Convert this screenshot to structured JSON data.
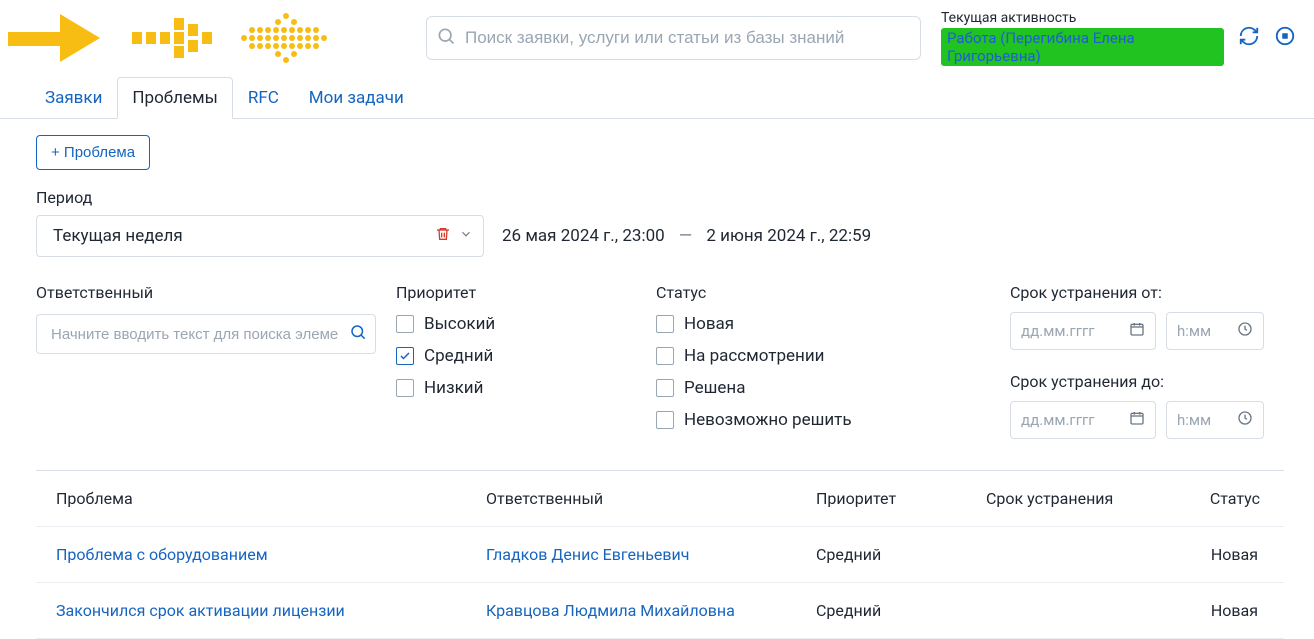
{
  "header": {
    "search_placeholder": "Поиск заявки, услуги или статьи из базы знаний",
    "activity_label": "Текущая активность",
    "activity_badge": "Работа (Перегибина Елена Григорьевна)"
  },
  "tabs": {
    "items": [
      "Заявки",
      "Проблемы",
      "RFC",
      "Мои задачи"
    ],
    "active_index": 1
  },
  "toolbar": {
    "add_button": "+ Проблема"
  },
  "filters": {
    "period_label": "Период",
    "period_value": "Текущая неделя",
    "period_from": "26 мая 2024 г., 23:00",
    "period_to": "2 июня 2024 г., 22:59",
    "responsible_label": "Ответственный",
    "responsible_placeholder": "Начните вводить текст для поиска элеме",
    "priority_label": "Приоритет",
    "priority_options": [
      {
        "label": "Высокий",
        "checked": false
      },
      {
        "label": "Средний",
        "checked": true
      },
      {
        "label": "Низкий",
        "checked": false
      }
    ],
    "status_label": "Статус",
    "status_options": [
      {
        "label": "Новая",
        "checked": false
      },
      {
        "label": "На рассмотрении",
        "checked": false
      },
      {
        "label": "Решена",
        "checked": false
      },
      {
        "label": "Невозможно решить",
        "checked": false
      }
    ],
    "due_from_label": "Срок устранения от:",
    "due_to_label": "Срок устранения до:",
    "date_placeholder": "дд.мм.гггг",
    "time_placeholder": "h:мм"
  },
  "table": {
    "headers": {
      "problem": "Проблема",
      "responsible": "Ответственный",
      "priority": "Приоритет",
      "due": "Срок устранения",
      "status": "Статус"
    },
    "rows": [
      {
        "problem": "Проблема с оборудованием",
        "responsible": "Гладков Денис Евгеньевич",
        "priority": "Средний",
        "due": "",
        "status": "Новая"
      },
      {
        "problem": "Закончился срок активации лицензии",
        "responsible": "Кравцова Людмила Михайловна",
        "priority": "Средний",
        "due": "",
        "status": "Новая"
      }
    ]
  }
}
